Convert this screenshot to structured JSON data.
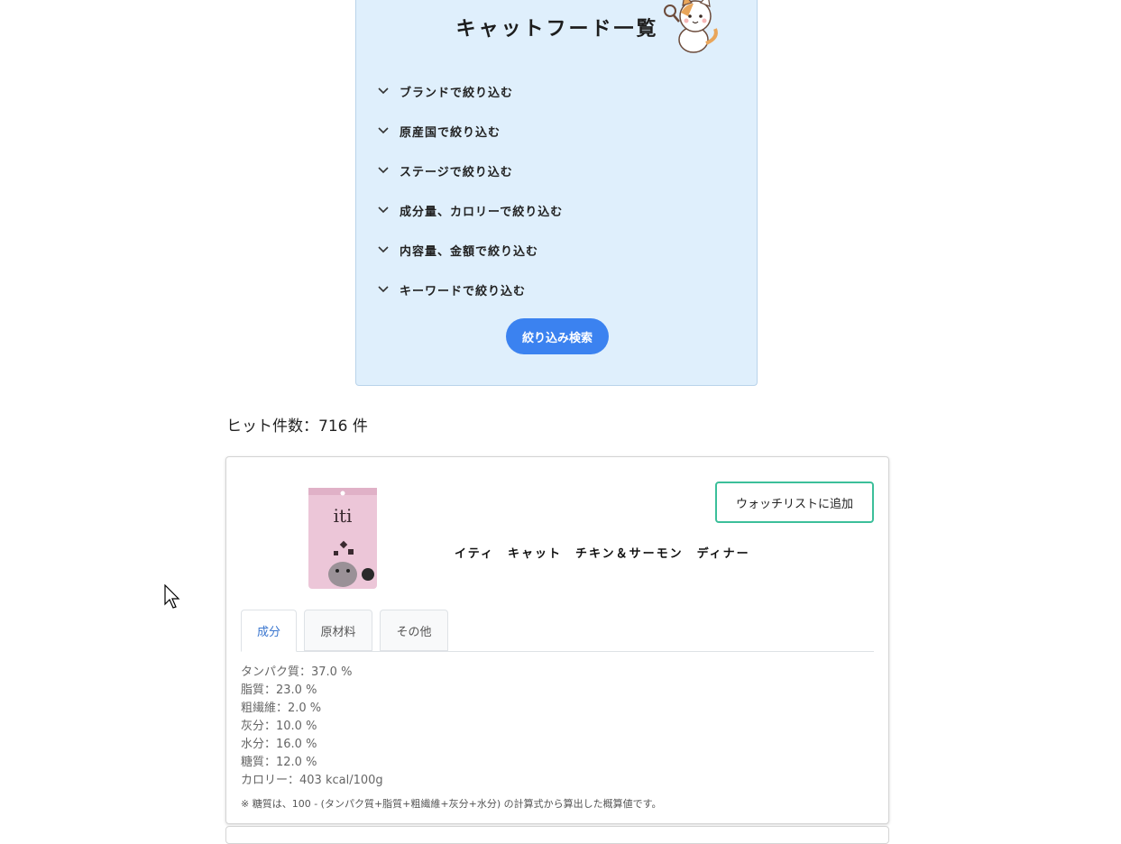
{
  "filter_panel": {
    "title": "キャットフード一覧",
    "filters": [
      {
        "label": "ブランドで絞り込む"
      },
      {
        "label": "原産国で絞り込む"
      },
      {
        "label": "ステージで絞り込む"
      },
      {
        "label": "成分量、カロリーで絞り込む"
      },
      {
        "label": "内容量、金額で絞り込む"
      },
      {
        "label": "キーワードで絞り込む"
      }
    ],
    "search_button": "絞り込み検索"
  },
  "results": {
    "hit_count": "ヒット件数：716 件"
  },
  "product": {
    "watchlist_button": "ウォッチリストに追加",
    "name": "イティ　キャット　チキン＆サーモン　ディナー",
    "image_brand_text": "iti",
    "tabs": [
      {
        "label": "成分",
        "active": true
      },
      {
        "label": "原材料",
        "active": false
      },
      {
        "label": "その他",
        "active": false
      }
    ],
    "nutrients": [
      "タンパク質：37.0 %",
      "脂質：23.0 %",
      "粗繊維：2.0 %",
      "灰分：10.0 %",
      "水分：16.0 %",
      "糖質：12.0 %",
      "カロリー：403 kcal/100g"
    ],
    "note": "※ 糖質は、100 - (タンパク質+脂質+粗繊維+灰分+水分) の計算式から算出した概算値です。"
  },
  "colors": {
    "panel_bg": "#dfeffc",
    "primary_button": "#3b82f0",
    "watch_border": "#3cbf9a",
    "active_tab": "#3a76cf"
  }
}
